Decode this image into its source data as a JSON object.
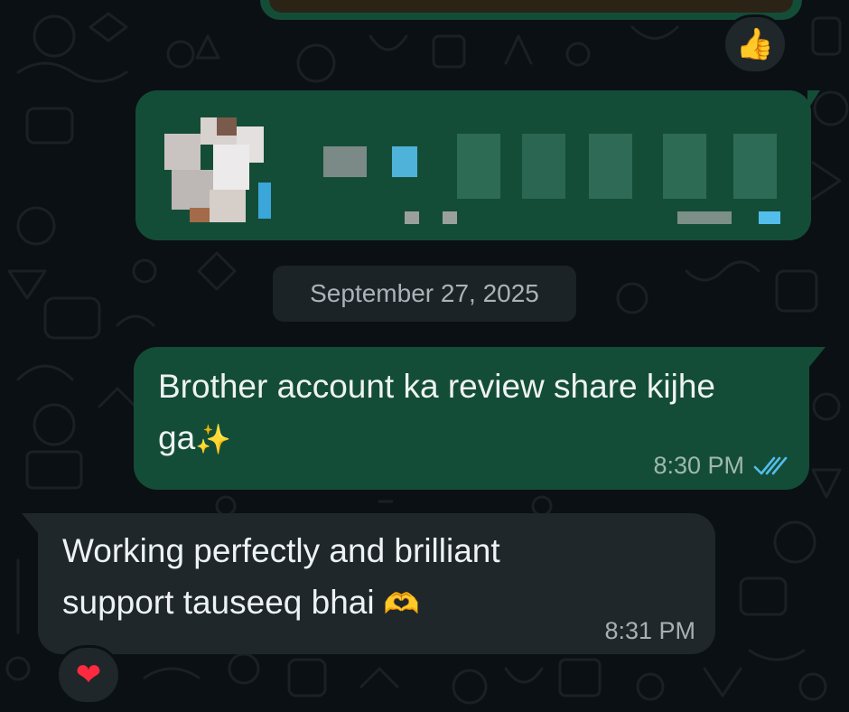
{
  "date_separator": "September 27, 2025",
  "messages": [
    {
      "direction": "outgoing",
      "text": "Brother account ka review share kijhe\nga",
      "emoji": "✨",
      "time": "8:30 PM",
      "status": "read"
    },
    {
      "direction": "incoming",
      "text": "Working perfectly and brilliant\nsupport tauseeq bhai ",
      "emoji": "🫶",
      "time": "8:31 PM"
    }
  ],
  "reactions": {
    "top_media": "👍",
    "incoming_message": "❤"
  },
  "colors": {
    "background": "#0b1014",
    "outgoing_bubble": "#144d37",
    "incoming_bubble": "#1f272b",
    "read_ticks": "#53bdeb",
    "date_chip": "#1c2327"
  },
  "icons": {
    "read_receipt": "double-check-icon",
    "reaction_thumbs": "thumbs-up-icon",
    "reaction_heart": "heart-icon"
  }
}
